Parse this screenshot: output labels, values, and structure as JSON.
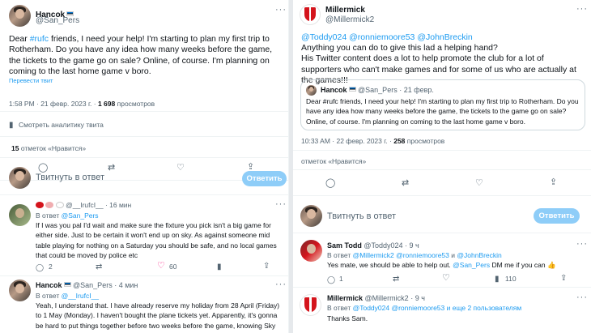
{
  "left": {
    "main_tweet": {
      "name": "Hancok",
      "handle": "@San_Pers",
      "body_prefix": "Dear ",
      "hashtag": "#rufc",
      "body_rest": " friends, I need your help! I'm starting to plan my first trip to Rotherham. Do you have any idea how many weeks before the game, the tickets to the game go on sale? Online, of course. I'm planning on coming to the last home game v boro.",
      "translate": "Перевести твит",
      "time": "1:58 PM · 21 февр. 2023 г. · ",
      "views_count": "1 698",
      "views_label": " просмотров",
      "analytics": "Смотреть аналитику твита",
      "likes_count": "15",
      "likes_label": " отметок «Нравится»"
    },
    "composer": {
      "placeholder": "Твитнуть в ответ",
      "button": "Ответить"
    },
    "reply1": {
      "name": "@__IrufcI__",
      "time": "· 16 мин",
      "reply_to_label": "В ответ ",
      "reply_to": "@San_Pers",
      "text": "If I was you pal I'd wait and make sure the fixture you pick isn't a big game for either side. Just to be certain it won't end up on sky. As against someone mid table playing for nothing on a Saturday you should be safe, and no local games that could be moved by police etc",
      "replies": "2",
      "likes": "60"
    },
    "reply2": {
      "name": "Hancok",
      "handle": "@San_Pers",
      "time": "· 4 мин",
      "reply_to_label": "В ответ ",
      "reply_to": "@__IrufcI__",
      "text": "Yeah, I understand that. I have already reserve my holiday from 28 April (Friday) to 1 May (Monday). I haven't bought the plane tickets yet. Apparently, it's gonna be hard to put things together before two weeks before the game, knowing Sky"
    }
  },
  "right": {
    "main_tweet": {
      "name": "Millermick",
      "handle": "@Millermick2",
      "mentions": "@Toddy024 @ronniemoore53 @JohnBreckin",
      "text": "Anything you can do to give this lad a helping hand?\nHis Twitter content does a lot to help promote the club for a lot of supporters who can't make games and for some of us who are actually at the games!!!",
      "quoted": {
        "name": "Hancok",
        "handle": "@San_Pers",
        "date": "· 21 февр.",
        "text": "Dear #rufc friends, I need your help! I'm starting to plan my first trip to Rotherham. Do you have any idea how many weeks before the game, the tickets to the game go on sale? Online, of course. I'm planning on coming to the last home game v boro."
      },
      "time": "10:33 AM · 22 февр. 2023 г. · ",
      "views_count": "258",
      "views_label": " просмотров",
      "likes": "отметок «Нравится»"
    },
    "composer": {
      "placeholder": "Твитнуть в ответ",
      "button": "Ответить"
    },
    "reply1": {
      "name": "Sam Todd",
      "handle": "@Toddy024",
      "time": "· 9 ч",
      "reply_to_label": "В ответ ",
      "reply_to": "@Millermick2 @ronniemoore53",
      "reply_to_and": " и ",
      "reply_to_last": "@JohnBreckin",
      "text_prefix": "Yes mate, we should be able to help out. ",
      "mention": "@San_Pers",
      "text_suffix": " DM me if you can 👍",
      "replies": "1",
      "likes": "110"
    },
    "reply2": {
      "name": "Millermick",
      "handle": "@Millermick2",
      "time": "· 9 ч",
      "reply_to_label": "В ответ ",
      "reply_to": "@Toddy024 @ronniemoore53",
      "reply_to_more": " и еще 2 пользователям",
      "text": "Thanks Sam."
    }
  },
  "colors": {
    "link": "#1d9bf0",
    "muted": "#536471",
    "button": "#8ecdf8"
  }
}
